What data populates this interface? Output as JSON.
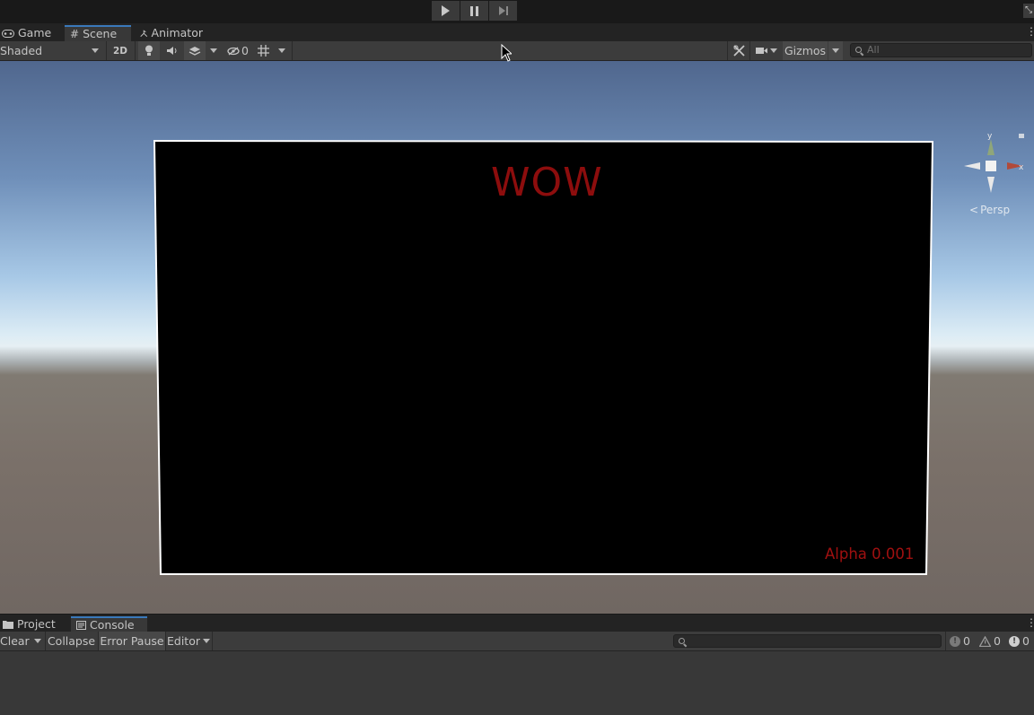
{
  "playbar": {
    "play": "play-icon",
    "pause": "pause-icon",
    "step": "step-icon"
  },
  "tabs": [
    {
      "label": "Game",
      "icon": "gamepad-icon"
    },
    {
      "label": "Scene",
      "icon": "hash-icon",
      "active": true
    },
    {
      "label": "Animator",
      "icon": "animator-icon"
    }
  ],
  "toolbar": {
    "draw_mode": "Shaded",
    "mode_2d": "2D",
    "hidden_count": "0",
    "gizmos": "Gizmos",
    "search_placeholder": "All"
  },
  "scene": {
    "title_text": "WOW",
    "alpha_text": "Alpha 0.001",
    "title_color": "#8d0d0d",
    "quad_color": "#000000"
  },
  "gizmo": {
    "x_label": "x",
    "y_label": "y",
    "projection": "Persp"
  },
  "console_tabs": [
    {
      "label": "Project",
      "icon": "folder-icon"
    },
    {
      "label": "Console",
      "icon": "console-icon",
      "active": true
    }
  ],
  "console_toolbar": {
    "clear": "Clear",
    "collapse": "Collapse",
    "error_pause": "Error Pause",
    "editor": "Editor",
    "info_count": "0",
    "warning_count": "0",
    "error_count": "0"
  },
  "colors": {
    "accent": "#3a79bb",
    "toolbar_bg": "#3c3c3c",
    "panel_bg": "#383838"
  }
}
